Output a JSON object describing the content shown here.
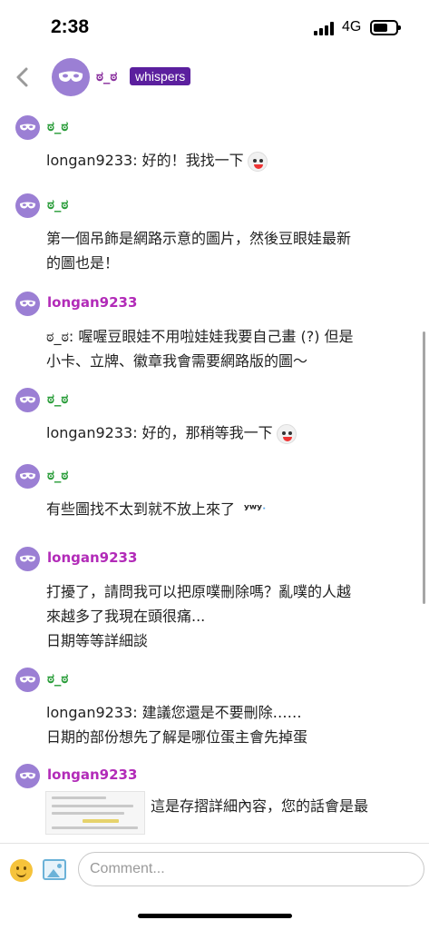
{
  "status_bar": {
    "time": "2:38",
    "network": "4G"
  },
  "header": {
    "name": "ಠ_ಠ",
    "badge": "whispers"
  },
  "messages": [
    {
      "user": "ಠ_ಠ",
      "lines": [
        "longan9233: 好的！我找一下"
      ]
    },
    {
      "user": "ಠ_ಠ",
      "lines": [
        "第一個吊飾是網路示意的圖片，然後豆眼娃最新",
        "的圖也是！"
      ]
    },
    {
      "user": "longan9233",
      "lines": [
        "ಠ_ಠ: 喔喔豆眼娃不用啦娃娃我要自己畫 (?) 但是",
        "小卡、立牌、徽章我會需要網路版的圖～"
      ]
    },
    {
      "user": "ಠ_ಠ",
      "lines": [
        "longan9233: 好的，那稍等我一下"
      ]
    },
    {
      "user": "ಠ_ಠ",
      "lines": [
        "有些圖找不太到就不放上來了"
      ],
      "sticker_text": "ʸʷʸ"
    },
    {
      "user": "longan9233",
      "lines": [
        "打擾了，請問我可以把原噗刪除嗎？亂噗的人越",
        "來越多了我現在頭很痛...",
        "日期等等詳細談"
      ]
    },
    {
      "user": "ಠ_ಠ",
      "lines": [
        "longan9233: 建議您還是不要刪除……",
        "日期的部份想先了解是哪位蛋主會先掉蛋"
      ]
    },
    {
      "user": "longan9233",
      "lines": [
        "這是存摺詳細內容，您的話會是最"
      ]
    }
  ],
  "comment": {
    "placeholder": "Comment..."
  },
  "colors": {
    "accent_purple": "#5b1f9e",
    "username_green": "#2a9d3a",
    "username_purple": "#b22bb8",
    "avatar": "#9b7fd4"
  },
  "icons": {
    "back": "chevron-left-icon",
    "avatar": "mask-icon",
    "emoji": "smiley-icon",
    "image": "image-icon"
  }
}
